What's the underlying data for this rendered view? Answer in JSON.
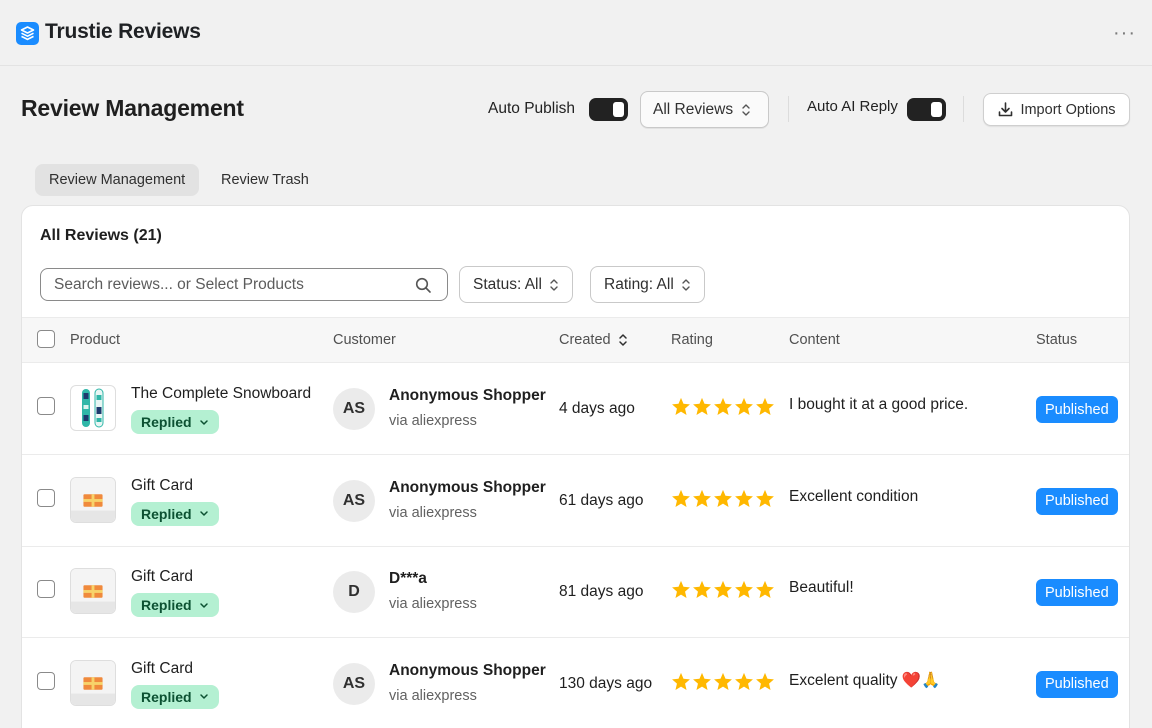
{
  "app": {
    "title": "Trustie Reviews",
    "more_label": "···"
  },
  "header": {
    "title": "Review Management",
    "auto_publish_label": "Auto Publish",
    "view_select": "All Reviews",
    "auto_ai_reply_label": "Auto AI Reply",
    "import_label": "Import Options"
  },
  "tabs": [
    {
      "label": "Review Management",
      "active": true
    },
    {
      "label": "Review Trash",
      "active": false
    }
  ],
  "card": {
    "title": "All Reviews (21)",
    "search_placeholder": "Search reviews... or Select Products",
    "status_filter": "Status: All",
    "rating_filter": "Rating: All"
  },
  "table": {
    "columns": [
      "Product",
      "Customer",
      "Created",
      "Rating",
      "Content",
      "Status"
    ],
    "rows": [
      {
        "product": "The Complete Snowboard",
        "thumb": "snowboard",
        "reply_status": "Replied",
        "initials": "AS",
        "customer": "Anonymous Shopper",
        "source": "via aliexpress",
        "created": "4 days ago",
        "rating": 5,
        "content": "I bought it at a good price.",
        "status": "Published"
      },
      {
        "product": "Gift Card",
        "thumb": "gift-card",
        "reply_status": "Replied",
        "initials": "AS",
        "customer": "Anonymous Shopper",
        "source": "via aliexpress",
        "created": "61 days ago",
        "rating": 5,
        "content": "Excellent condition",
        "status": "Published"
      },
      {
        "product": "Gift Card",
        "thumb": "gift-card",
        "reply_status": "Replied",
        "initials": "D",
        "customer": "D***a",
        "source": "via aliexpress",
        "created": "81 days ago",
        "rating": 5,
        "content": "Beautiful!",
        "status": "Published"
      },
      {
        "product": "Gift Card",
        "thumb": "gift-card",
        "reply_status": "Replied",
        "initials": "AS",
        "customer": "Anonymous Shopper",
        "source": "via aliexpress",
        "created": "130 days ago",
        "rating": 5,
        "content": "Excelent quality ❤️🙏",
        "status": "Published"
      }
    ]
  },
  "colors": {
    "accent": "#1a8cff",
    "star": "#ffb800",
    "replied_bg": "#b4f0d2",
    "replied_text": "#0c5132",
    "toggle_on": "#222222"
  }
}
